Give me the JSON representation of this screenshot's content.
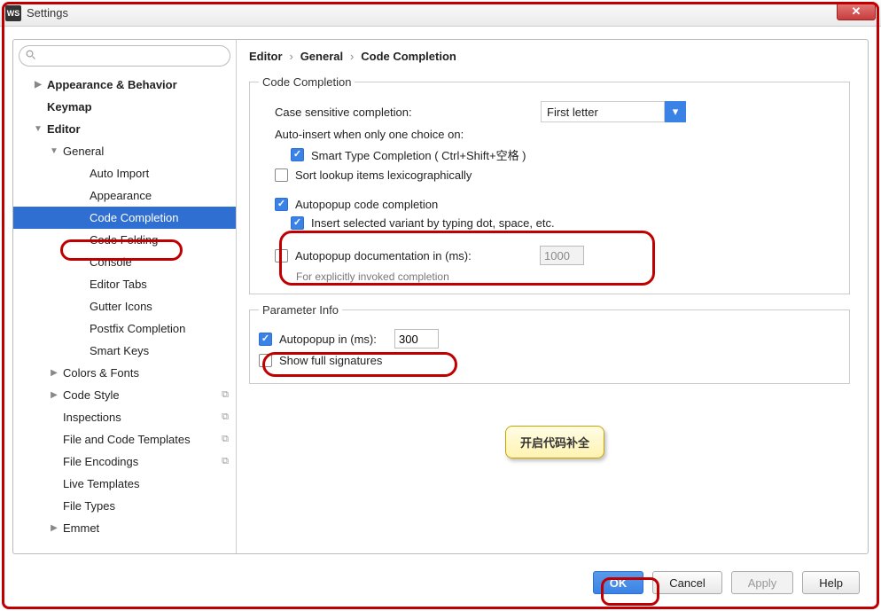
{
  "window": {
    "title": "Settings",
    "app_icon_text": "WS"
  },
  "search": {
    "placeholder": ""
  },
  "sidebar": {
    "items": [
      {
        "label": "Appearance & Behavior",
        "bold": true,
        "level": 0,
        "arrow": "▶"
      },
      {
        "label": "Keymap",
        "bold": true,
        "level": 0,
        "arrow": ""
      },
      {
        "label": "Editor",
        "bold": true,
        "level": 0,
        "arrow": "▼"
      },
      {
        "label": "General",
        "level": 1,
        "arrow": "▼"
      },
      {
        "label": "Auto Import",
        "level": 3
      },
      {
        "label": "Appearance",
        "level": 3
      },
      {
        "label": "Code Completion",
        "level": 3,
        "selected": true
      },
      {
        "label": "Code Folding",
        "level": 3
      },
      {
        "label": "Console",
        "level": 3
      },
      {
        "label": "Editor Tabs",
        "level": 3
      },
      {
        "label": "Gutter Icons",
        "level": 3
      },
      {
        "label": "Postfix Completion",
        "level": 3
      },
      {
        "label": "Smart Keys",
        "level": 3
      },
      {
        "label": "Colors & Fonts",
        "level": 1,
        "arrow": "▶"
      },
      {
        "label": "Code Style",
        "level": 1,
        "arrow": "▶",
        "copy": true
      },
      {
        "label": "Inspections",
        "level": 1,
        "copy": true
      },
      {
        "label": "File and Code Templates",
        "level": 1,
        "copy": true
      },
      {
        "label": "File Encodings",
        "level": 1,
        "copy": true
      },
      {
        "label": "Live Templates",
        "level": 1
      },
      {
        "label": "File Types",
        "level": 1
      },
      {
        "label": "Emmet",
        "level": 1,
        "arrow": "▶"
      }
    ]
  },
  "breadcrumb": {
    "a": "Editor",
    "b": "General",
    "c": "Code Completion"
  },
  "section": {
    "code_completion_legend": "Code Completion",
    "case_sensitive_label": "Case sensitive completion:",
    "case_sensitive_value": "First letter",
    "auto_insert_label": "Auto-insert when only one choice on:",
    "smart_type_label": "Smart Type Completion ( Ctrl+Shift+空格 )",
    "sort_lookup_label": "Sort lookup items lexicographically",
    "autopopup_code_label": "Autopopup code completion",
    "insert_variant_label": "Insert selected variant by typing dot, space, etc.",
    "autopopup_doc_label": "Autopopup documentation in (ms):",
    "autopopup_doc_value": "1000",
    "explicit_note": "For explicitly invoked completion",
    "param_info_legend": "Parameter Info",
    "autopopup_in_label": "Autopopup in (ms):",
    "autopopup_in_value": "300",
    "show_sig_label": "Show full signatures"
  },
  "tooltip": {
    "text": "开启代码补全"
  },
  "buttons": {
    "ok": "OK",
    "cancel": "Cancel",
    "apply": "Apply",
    "help": "Help"
  }
}
